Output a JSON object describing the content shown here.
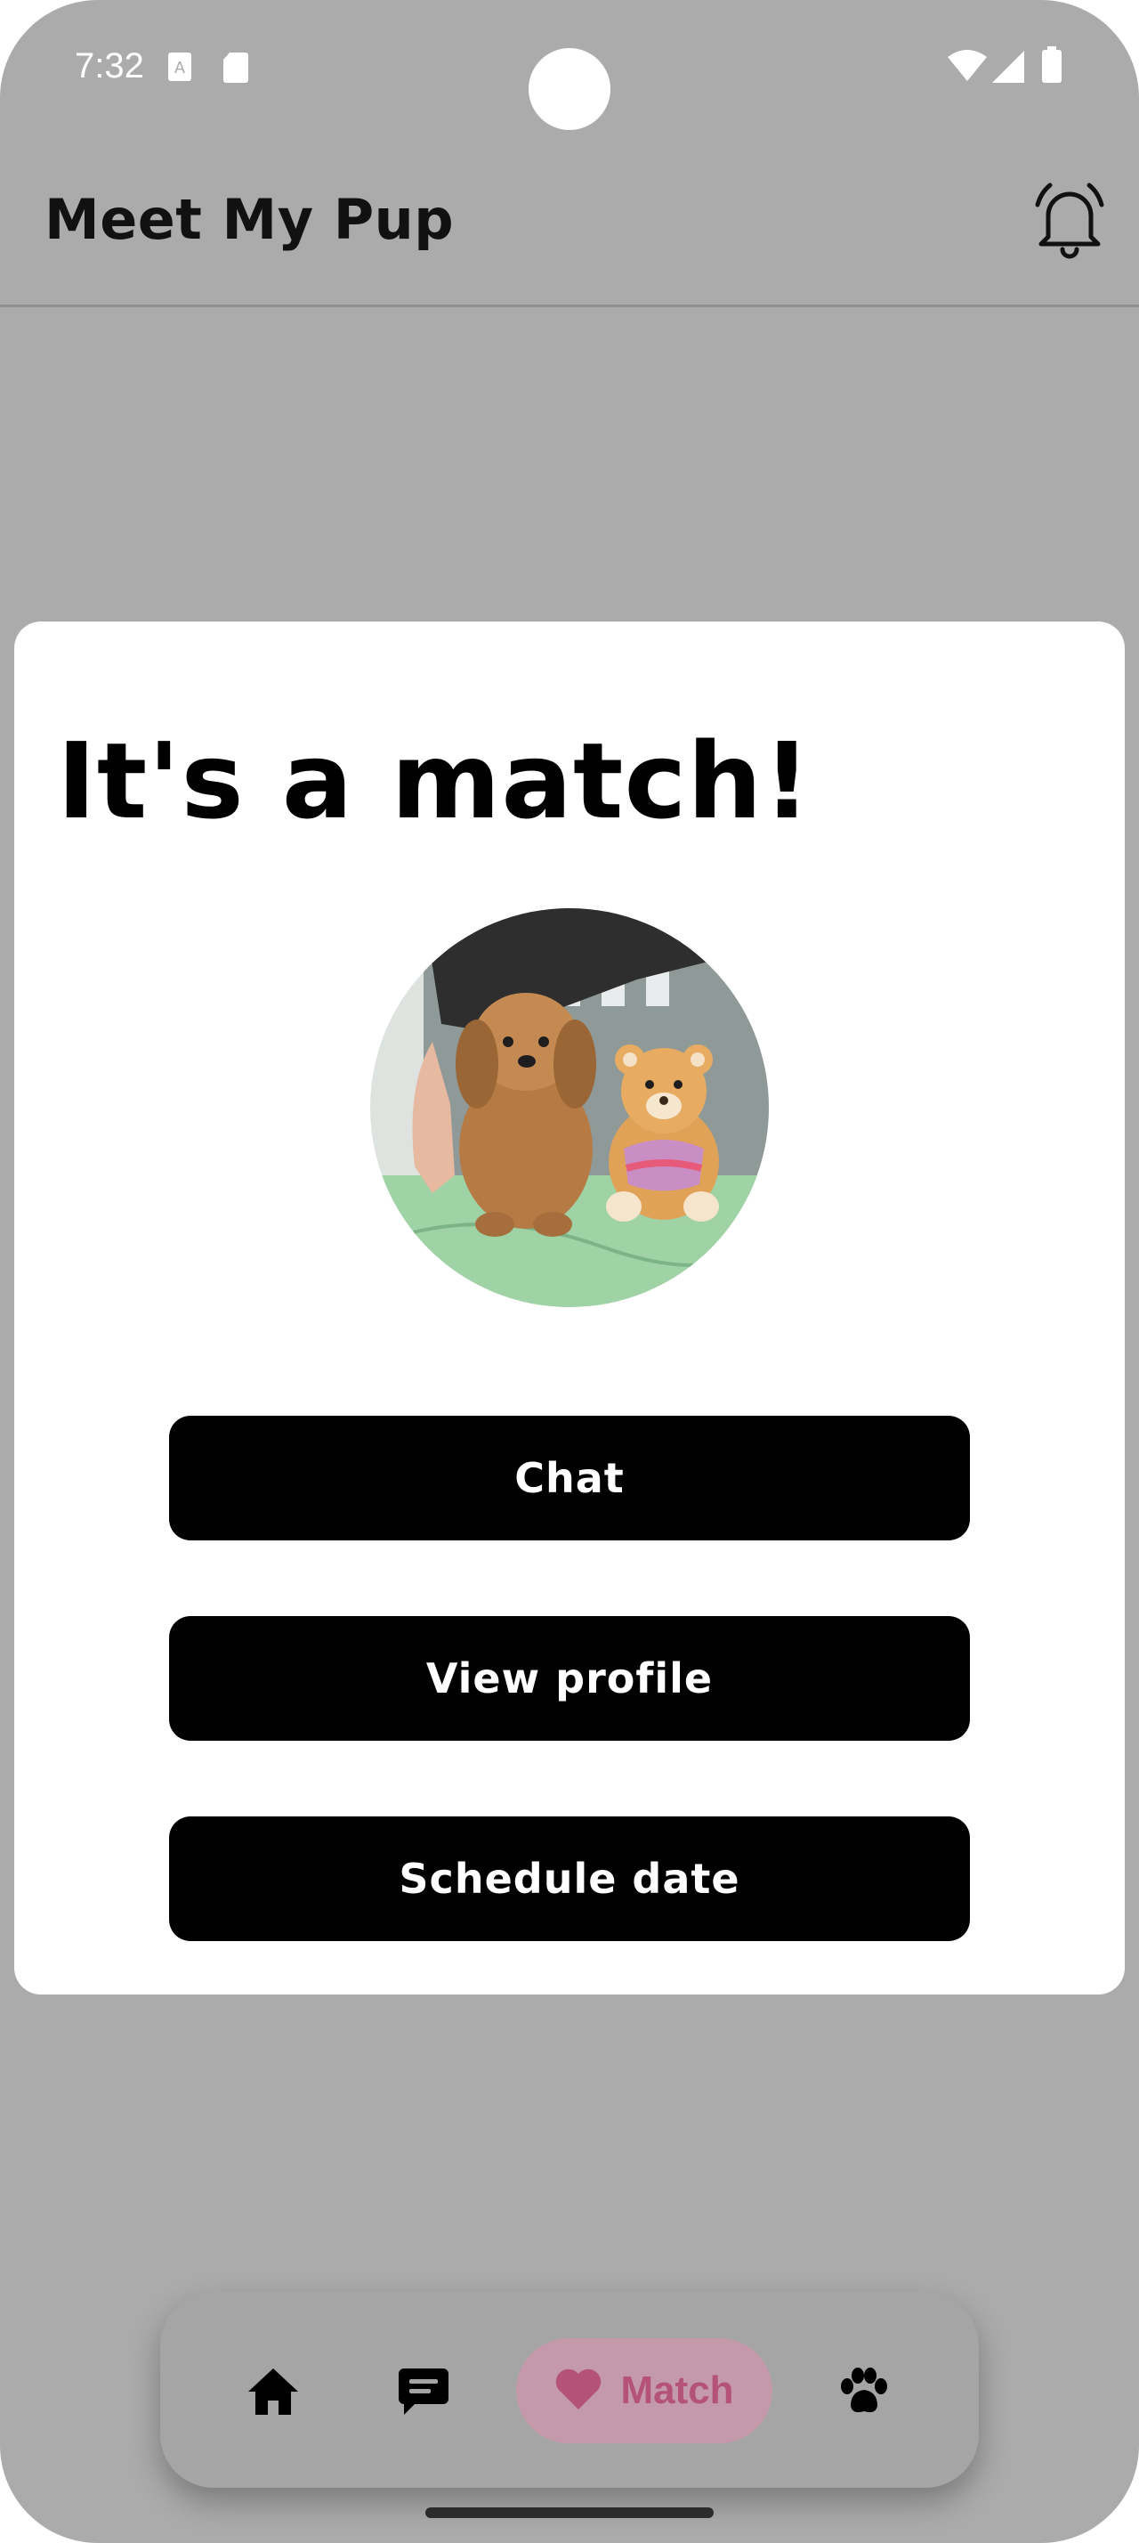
{
  "status_bar": {
    "time": "7:32",
    "left_icons": [
      "text-recognition-icon",
      "sd-card-icon"
    ],
    "right_icons": [
      "wifi-icon",
      "signal-icon",
      "battery-icon"
    ]
  },
  "app_bar": {
    "title": "Meet My Pup",
    "notifications_icon": "bell-icon"
  },
  "match_dialog": {
    "title": "It's a match!",
    "photo": "dog-photo-with-teddy-bear",
    "buttons": {
      "chat": "Chat",
      "view_profile": "View profile",
      "schedule_date": "Schedule date"
    }
  },
  "bottom_nav": {
    "items": [
      {
        "icon": "home-icon",
        "label": ""
      },
      {
        "icon": "chat-bubble-icon",
        "label": ""
      },
      {
        "icon": "heart-icon",
        "label": "Match",
        "selected": true
      },
      {
        "icon": "paw-icon",
        "label": ""
      }
    ]
  },
  "colors": {
    "scrim": "#ababab",
    "accent": "#b55277",
    "selected_pill": "#c49aab",
    "button": "#000000"
  }
}
